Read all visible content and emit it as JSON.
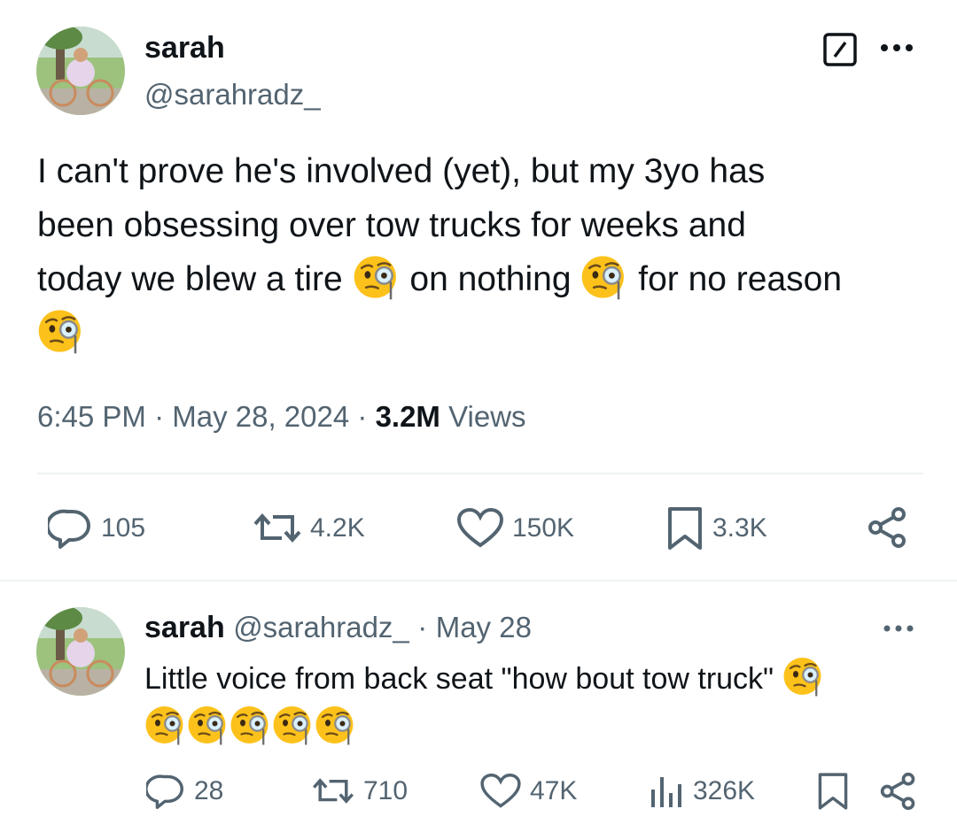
{
  "tweet": {
    "author_name": "sarah",
    "author_handle": "@sarahradz_",
    "text_line1": "I can't prove he's involved (yet), but my 3yo has",
    "text_line2": "been obsessing over tow trucks for weeks and",
    "text_line3a": "today we blew a tire",
    "text_line3b": "on nothing",
    "text_line3c": "for no reason",
    "emoji": "face-with-monocle-icon",
    "time": "6:45 PM",
    "separator": "·",
    "date": "May 28, 2024",
    "views_count": "3.2M",
    "views_label": "Views",
    "replies": "105",
    "reposts": "4.2K",
    "likes": "150K",
    "bookmarks": "3.3K"
  },
  "reply": {
    "author_name": "sarah",
    "author_handle": "@sarahradz_",
    "date": "May 28",
    "separator": "·",
    "text": "Little voice from back seat \"how bout tow truck\"",
    "replies": "28",
    "reposts": "710",
    "likes": "47K",
    "views": "326K"
  },
  "colors": {
    "text": "#0f1419",
    "secondary": "#536471",
    "divider": "#eff3f4",
    "emoji_yellow": "#fbc531"
  }
}
